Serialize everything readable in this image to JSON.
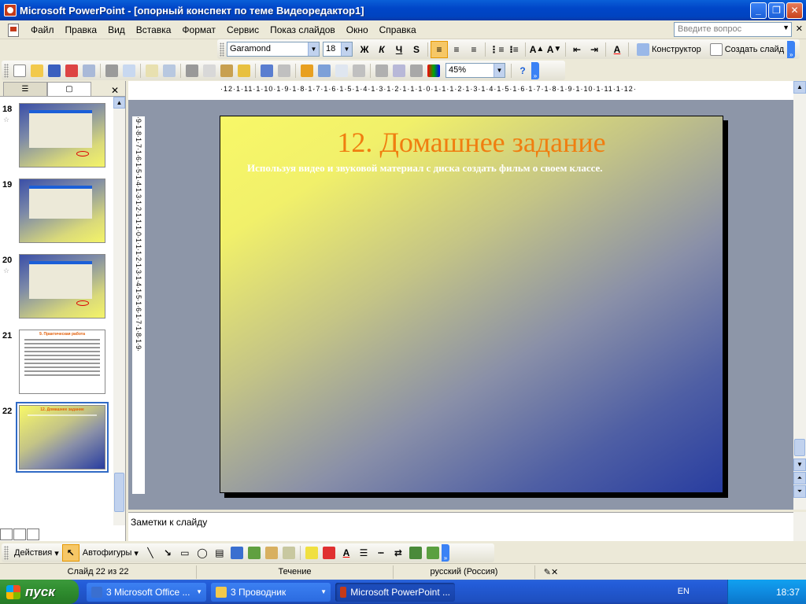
{
  "window": {
    "title": "Microsoft PowerPoint - [опорный конспект по теме Видеоредактор1]",
    "minimize": "_",
    "restore": "❐",
    "close": "✕"
  },
  "menu": {
    "items": [
      "Файл",
      "Правка",
      "Вид",
      "Вставка",
      "Формат",
      "Сервис",
      "Показ слайдов",
      "Окно",
      "Справка"
    ],
    "help_placeholder": "Введите вопрос",
    "doc_close": "✕"
  },
  "formatting": {
    "font": "Garamond",
    "size": "18",
    "bold": "Ж",
    "italic": "К",
    "underline": "Ч",
    "shadow": "S",
    "grow_font": "A",
    "shrink_font": "A",
    "font_color": "A",
    "designer": "Конструктор",
    "new_slide": "Создать слайд"
  },
  "standard": {
    "zoom": "45%",
    "help": "?"
  },
  "left_pane": {
    "tab_outline": "☰",
    "tab_slides": "▢",
    "close": "✕",
    "slides": [
      {
        "num": "18",
        "star": "☆"
      },
      {
        "num": "19",
        "star": ""
      },
      {
        "num": "20",
        "star": "☆"
      },
      {
        "num": "21",
        "star": ""
      },
      {
        "num": "22",
        "star": ""
      }
    ]
  },
  "rulers": {
    "horizontal": "·12·1·11·1·10·1·9·1·8·1·7·1·6·1·5·1·4·1·3·1·2·1·1·1·0·1·1·1·2·1·3·1·4·1·5·1·6·1·7·1·8·1·9·1·10·1·11·1·12·",
    "vertical": "·9·1·8·1·7·1·6·1·5·1·4·1·3·1·2·1·1·1·0·1·1·1·2·1·3·1·4·1·5·1·6·1·7·1·8·1·9·"
  },
  "slide": {
    "title": "12. Домашнее задание",
    "body": "Используя видео и  звуковой материал с диска создать фильм о своем классе.",
    "mini_title_21": "9. Практическая работа",
    "mini_title_22": "12. Домашнее задание"
  },
  "notes": {
    "placeholder": "Заметки к слайду"
  },
  "drawing": {
    "actions": "Действия",
    "autoshapes": "Автофигуры"
  },
  "status": {
    "slide": "Слайд 22 из 22",
    "design": "Течение",
    "language": "русский (Россия)"
  },
  "taskbar": {
    "start": "пуск",
    "tasks": [
      "3 Microsoft Office ...",
      "3 Проводник",
      "Microsoft PowerPoint ..."
    ],
    "lang": "EN",
    "time": "18:37"
  },
  "colors": {
    "title_orange": "#f07e10",
    "slide_gradient_start": "#f8f868",
    "slide_gradient_end": "#283da0",
    "xp_blue": "#0046c8"
  }
}
